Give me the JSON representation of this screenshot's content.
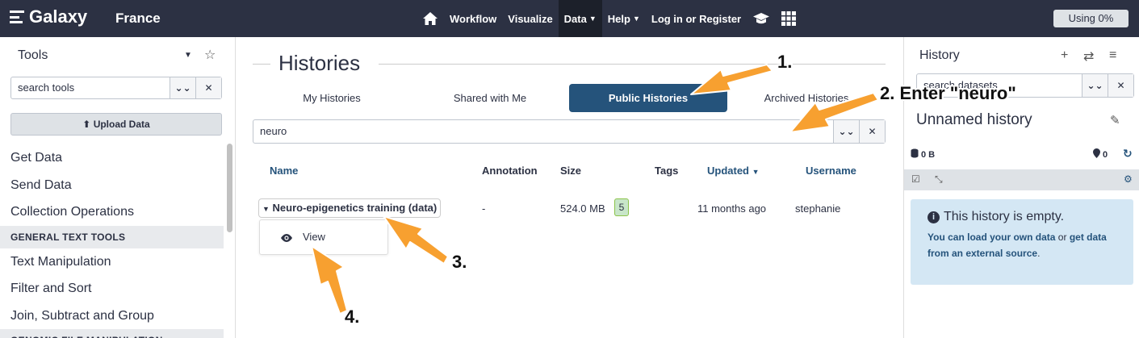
{
  "masthead": {
    "brand": "Galaxy",
    "brand_sub": "France",
    "nav": [
      {
        "label": "Workflow"
      },
      {
        "label": "Visualize"
      },
      {
        "label": "Data"
      },
      {
        "label": "Help"
      },
      {
        "label": "Log in or Register"
      }
    ],
    "quota": "Using 0%"
  },
  "tool_panel": {
    "title": "Tools",
    "search_placeholder": "search tools",
    "upload_label": "Upload Data",
    "items": [
      {
        "label": "Get Data"
      },
      {
        "label": "Send Data"
      },
      {
        "label": "Collection Operations"
      }
    ],
    "section_general": "GENERAL TEXT TOOLS",
    "items_general": [
      {
        "label": "Text Manipulation"
      },
      {
        "label": "Filter and Sort"
      },
      {
        "label": "Join, Subtract and Group"
      }
    ],
    "section_genomic": "GENOMIC FILE MANIPULATION"
  },
  "center": {
    "title": "Histories",
    "tabs": [
      {
        "label": "My Histories"
      },
      {
        "label": "Shared with Me"
      },
      {
        "label": "Public Histories"
      },
      {
        "label": "Archived Histories"
      }
    ],
    "filter_value": "neuro",
    "columns": {
      "name": "Name",
      "annotation": "Annotation",
      "size": "Size",
      "tags": "Tags",
      "updated": "Updated",
      "username": "Username"
    },
    "row": {
      "name": "Neuro-epigenetics training (data)",
      "annotation": "-",
      "size": "524.0 MB",
      "badge": "5",
      "updated": "11 months ago",
      "username": "stephanie"
    },
    "dropdown_view": "View"
  },
  "history_panel": {
    "title": "History",
    "search_placeholder": "search datasets",
    "history_name": "Unnamed history",
    "size": "0 B",
    "count": "0",
    "empty_title": "This history is empty.",
    "empty_link1": "You can load your own data",
    "empty_or": " or ",
    "empty_link2": "get data from an external source",
    "empty_end": "."
  },
  "annotations": {
    "step1": "1.",
    "step2": "2. Enter \"neuro\"",
    "step3": "3.",
    "step4": "4.",
    "arrow_color": "#f7a030"
  },
  "colors": {
    "masthead": "#2c3143",
    "accent": "#25537b",
    "info_bg": "#d4e7f4"
  }
}
